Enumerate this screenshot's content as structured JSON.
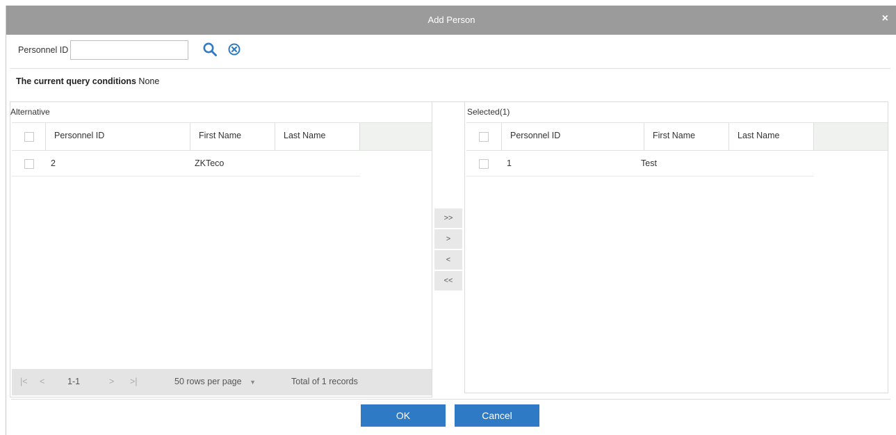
{
  "dialog": {
    "title": "Add Person",
    "close_glyph": "×"
  },
  "search": {
    "label": "Personnel ID",
    "value": "",
    "placeholder": "",
    "search_icon": "search-icon",
    "clear_icon": "clear-circle-icon"
  },
  "query": {
    "prefix": "The current query conditions",
    "value": "None"
  },
  "alternative": {
    "title": "Alternative",
    "columns": [
      "Personnel ID",
      "First Name",
      "Last Name"
    ],
    "rows": [
      {
        "id": "2",
        "first": "ZKTeco",
        "last": ""
      }
    ],
    "pager": {
      "first": "|<",
      "prev": "<",
      "range": "1-1",
      "next": ">",
      "last": ">|",
      "rows_per_page": "50 rows per page",
      "total": "Total of 1 records"
    }
  },
  "transfer": {
    "all_right": ">>",
    "right": ">",
    "left": "<",
    "all_left": "<<"
  },
  "selected": {
    "title": "Selected(1)",
    "columns": [
      "Personnel ID",
      "First Name",
      "Last Name"
    ],
    "rows": [
      {
        "id": "1",
        "first": "Test",
        "last": ""
      }
    ]
  },
  "footer": {
    "ok": "OK",
    "cancel": "Cancel"
  },
  "colors": {
    "titlebar": "#9b9b9b",
    "accent": "#2f7ac5",
    "header_bg": "#f0f2ef",
    "pager_bg": "#e4e4e4"
  }
}
